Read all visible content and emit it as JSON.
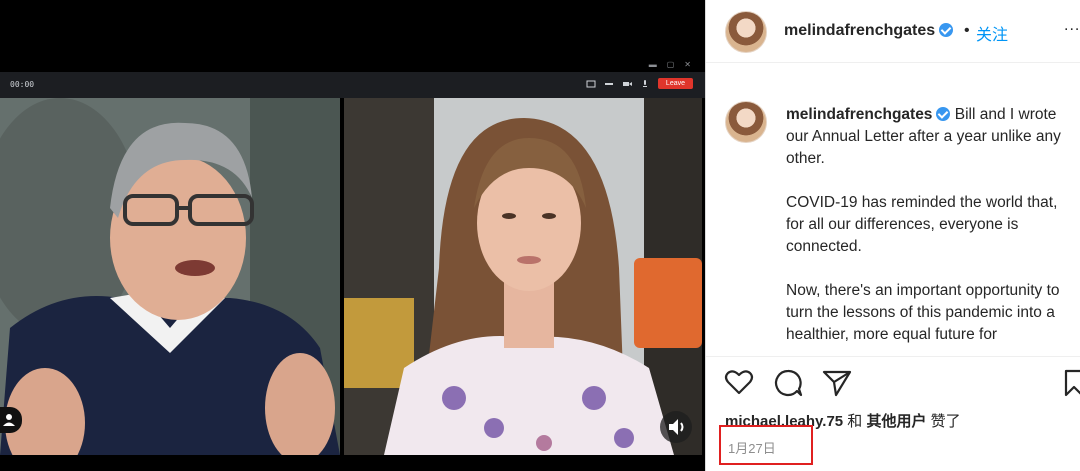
{
  "video_call": {
    "call_time": "00:00",
    "leave_label": "Leave",
    "icons": [
      "screen-share-icon",
      "minimize-icon",
      "camera-icon",
      "mic-icon",
      "avatar-icon",
      "volume-icon"
    ]
  },
  "instagram": {
    "header": {
      "username": "melindafrenchgates",
      "dot": "•",
      "follow_label": "关注",
      "more": "..."
    },
    "caption": {
      "username": "melindafrenchgates",
      "text_1": " Bill and I wrote our Annual Letter after a year unlike any other.",
      "text_2": "COVID-19 has reminded the world that, for all our differences, everyone is connected.",
      "text_3": "Now, there's an important opportunity to turn the lessons of this pandemic into a healthier, more equal future for"
    },
    "likes": {
      "user": "michael.leahy.75",
      "and": " 和 ",
      "others": "其他用户",
      "liked": " 赞了"
    },
    "date": "1月27日",
    "colors": {
      "link": "#0095f6",
      "highlight_box": "#e02020",
      "verified": "#3897f0"
    }
  }
}
